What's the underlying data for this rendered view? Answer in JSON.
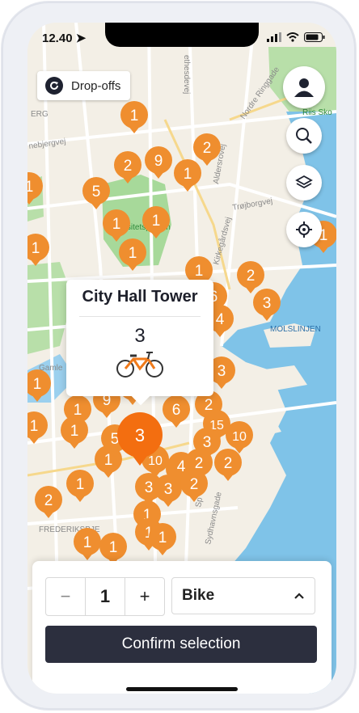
{
  "status": {
    "time": "12.40"
  },
  "map": {
    "dropoffs_label": "Drop-offs",
    "place_labels": [
      "ERG",
      "ethesdevej",
      "nebjergvej",
      "Aldersrovej",
      "Nordre Ringgade",
      "Trøjborgvej",
      "Kirkegårdsvej",
      "Riis Sko",
      "Universitetsparken",
      "MOLSLINJEN",
      "Gamle",
      "FREDERIKSBJE",
      "Sydhavnsgade",
      "Sp"
    ],
    "markers": [
      {
        "label": "1"
      },
      {
        "label": "2"
      },
      {
        "label": "9"
      },
      {
        "label": "2"
      },
      {
        "label": "1"
      },
      {
        "label": "5"
      },
      {
        "label": "1"
      },
      {
        "label": "1"
      },
      {
        "label": "1"
      },
      {
        "label": "1"
      },
      {
        "label": "2"
      },
      {
        "label": "4"
      },
      {
        "label": "3"
      },
      {
        "label": "6"
      },
      {
        "label": "4"
      },
      {
        "label": "3"
      },
      {
        "label": "1"
      },
      {
        "label": "9"
      },
      {
        "label": "6"
      },
      {
        "label": "2"
      },
      {
        "label": "15"
      },
      {
        "label": "10"
      },
      {
        "label": "4"
      },
      {
        "label": "1"
      },
      {
        "label": "1"
      },
      {
        "label": "5"
      },
      {
        "label": "10"
      },
      {
        "label": "3"
      },
      {
        "label": "2"
      },
      {
        "label": "4"
      },
      {
        "label": "2"
      },
      {
        "label": "3"
      },
      {
        "label": "3"
      },
      {
        "label": "2"
      },
      {
        "label": "1"
      },
      {
        "label": "2"
      },
      {
        "label": "1"
      },
      {
        "label": "1"
      },
      {
        "label": "1"
      },
      {
        "label": "1"
      },
      {
        "label": "1"
      },
      {
        "label": "1"
      },
      {
        "label": "1"
      },
      {
        "label": "1"
      },
      {
        "label": "1"
      },
      {
        "label": "1"
      }
    ],
    "selected_marker_label": "3"
  },
  "popup": {
    "title": "City Hall Tower",
    "count": "3",
    "vehicle_icon": "bicycle-icon"
  },
  "panel": {
    "quantity": "1",
    "minus_label": "−",
    "plus_label": "+",
    "vehicle_type": "Bike",
    "confirm_label": "Confirm selection"
  },
  "colors": {
    "marker": "#ef8e2f",
    "marker_selected": "#f36e10",
    "water": "#7fc3e8",
    "park": "#a7d99a",
    "button_dark": "#2c2f3e"
  }
}
